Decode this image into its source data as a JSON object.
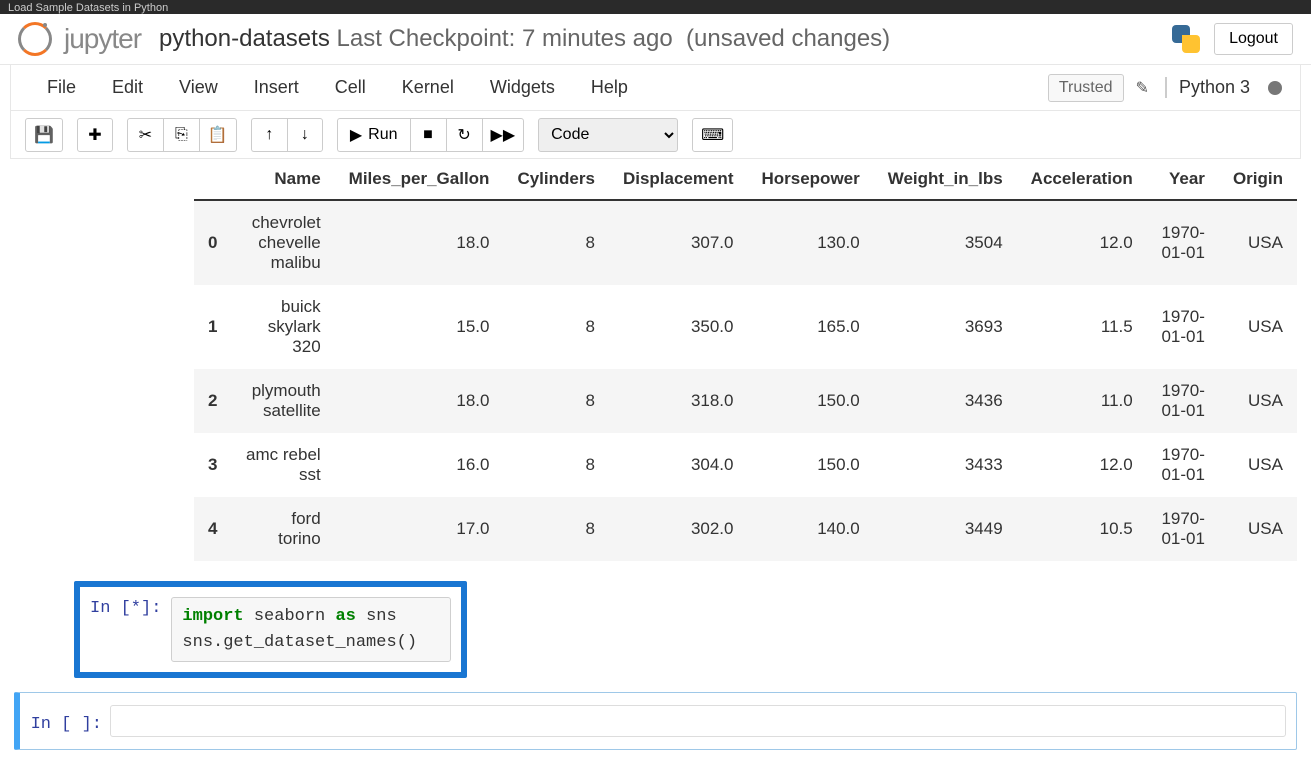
{
  "browser_tab": "Load Sample Datasets in Python",
  "header": {
    "logo_text": "jupyter",
    "notebook_name": "python-datasets",
    "checkpoint": "Last Checkpoint: 7 minutes ago",
    "autosave_status": "(unsaved changes)",
    "logout": "Logout"
  },
  "menubar": {
    "items": [
      "File",
      "Edit",
      "View",
      "Insert",
      "Cell",
      "Kernel",
      "Widgets",
      "Help"
    ],
    "trusted": "Trusted",
    "kernel": "Python 3"
  },
  "toolbar": {
    "run_label": "Run",
    "cell_type": "Code"
  },
  "table": {
    "columns": [
      "Name",
      "Miles_per_Gallon",
      "Cylinders",
      "Displacement",
      "Horsepower",
      "Weight_in_lbs",
      "Acceleration",
      "Year",
      "Origin"
    ],
    "rows": [
      {
        "idx": "0",
        "Name": "chevrolet chevelle malibu",
        "Miles_per_Gallon": "18.0",
        "Cylinders": "8",
        "Displacement": "307.0",
        "Horsepower": "130.0",
        "Weight_in_lbs": "3504",
        "Acceleration": "12.0",
        "Year": "1970-01-01",
        "Origin": "USA"
      },
      {
        "idx": "1",
        "Name": "buick skylark 320",
        "Miles_per_Gallon": "15.0",
        "Cylinders": "8",
        "Displacement": "350.0",
        "Horsepower": "165.0",
        "Weight_in_lbs": "3693",
        "Acceleration": "11.5",
        "Year": "1970-01-01",
        "Origin": "USA"
      },
      {
        "idx": "2",
        "Name": "plymouth satellite",
        "Miles_per_Gallon": "18.0",
        "Cylinders": "8",
        "Displacement": "318.0",
        "Horsepower": "150.0",
        "Weight_in_lbs": "3436",
        "Acceleration": "11.0",
        "Year": "1970-01-01",
        "Origin": "USA"
      },
      {
        "idx": "3",
        "Name": "amc rebel sst",
        "Miles_per_Gallon": "16.0",
        "Cylinders": "8",
        "Displacement": "304.0",
        "Horsepower": "150.0",
        "Weight_in_lbs": "3433",
        "Acceleration": "12.0",
        "Year": "1970-01-01",
        "Origin": "USA"
      },
      {
        "idx": "4",
        "Name": "ford torino",
        "Miles_per_Gallon": "17.0",
        "Cylinders": "8",
        "Displacement": "302.0",
        "Horsepower": "140.0",
        "Weight_in_lbs": "3449",
        "Acceleration": "10.5",
        "Year": "1970-01-01",
        "Origin": "USA"
      }
    ]
  },
  "cells": {
    "running": {
      "prompt": "In [*]:",
      "code_tokens": [
        {
          "t": "import",
          "c": "kw-green"
        },
        {
          "t": " seaborn ",
          "c": ""
        },
        {
          "t": "as",
          "c": "kw-green"
        },
        {
          "t": " sns",
          "c": ""
        },
        {
          "t": "\n",
          "c": ""
        },
        {
          "t": "sns.get_dataset_names()",
          "c": ""
        }
      ]
    },
    "empty": {
      "prompt": "In [ ]:",
      "code": ""
    }
  }
}
